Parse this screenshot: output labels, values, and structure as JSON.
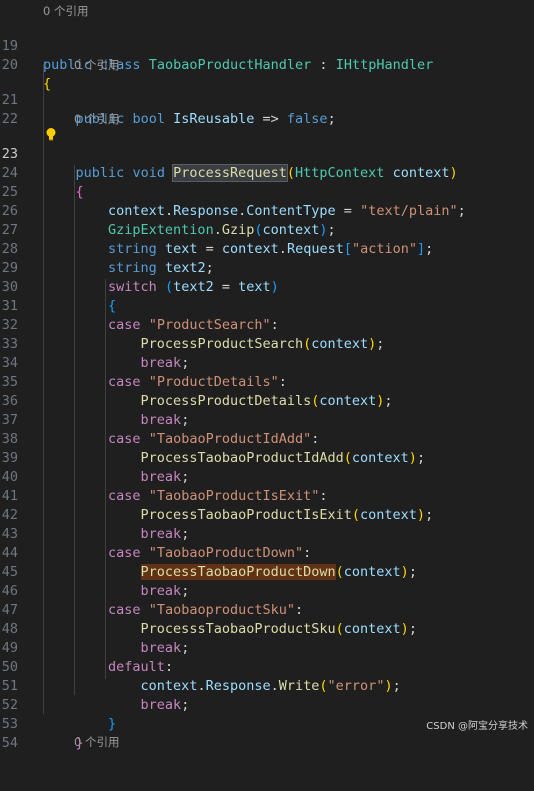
{
  "codelens": {
    "references": "0 个引用"
  },
  "watermark": "CSDN @阿宝分享技术",
  "line_numbers": [
    "19",
    "20",
    "21",
    "22",
    "23",
    "24",
    "25",
    "26",
    "27",
    "28",
    "29",
    "30",
    "31",
    "32",
    "33",
    "34",
    "35",
    "36",
    "37",
    "38",
    "39",
    "40",
    "41",
    "42",
    "43",
    "44",
    "45",
    "46",
    "47",
    "48",
    "49",
    "50",
    "51",
    "52",
    "53",
    "54"
  ],
  "tokens": {
    "public": "public",
    "class": "class",
    "bool": "bool",
    "void": "void",
    "string": "string",
    "switch": "switch",
    "case": "case",
    "break": "break",
    "default": "default",
    "false": "false",
    "class_name": "TaobaoProductHandler",
    "interface": "IHttpHandler",
    "is_reusable": "IsReusable",
    "process_request": "ProcessRequest",
    "http_context": "HttpContext",
    "context": "context",
    "response": "Response",
    "content_type": "ContentType",
    "str_text_plain": "\"text/plain\"",
    "gzip_ext": "GzipExtention",
    "gzip": "Gzip",
    "request": "Request",
    "str_action": "\"action\"",
    "text": "text",
    "text2": "text2",
    "str_product_search": "\"ProductSearch\"",
    "m_product_search": "ProcessProductSearch",
    "str_product_details": "\"ProductDetails\"",
    "m_product_details": "ProcessProductDetails",
    "str_idadd": "\"TaobaoProductIdAdd\"",
    "m_idadd": "ProcessTaobaoProductIdAdd",
    "str_isexit": "\"TaobaoProductIsExit\"",
    "m_isexit": "ProcessTaobaoProductIsExit",
    "str_down": "\"TaobaoProductDown\"",
    "m_down": "ProcessTaobaoProductDown",
    "str_sku": "\"TaobaoproductSku\"",
    "m_sku": "ProcesssTaobaoProductSku",
    "write": "Write",
    "str_error": "\"error\""
  }
}
